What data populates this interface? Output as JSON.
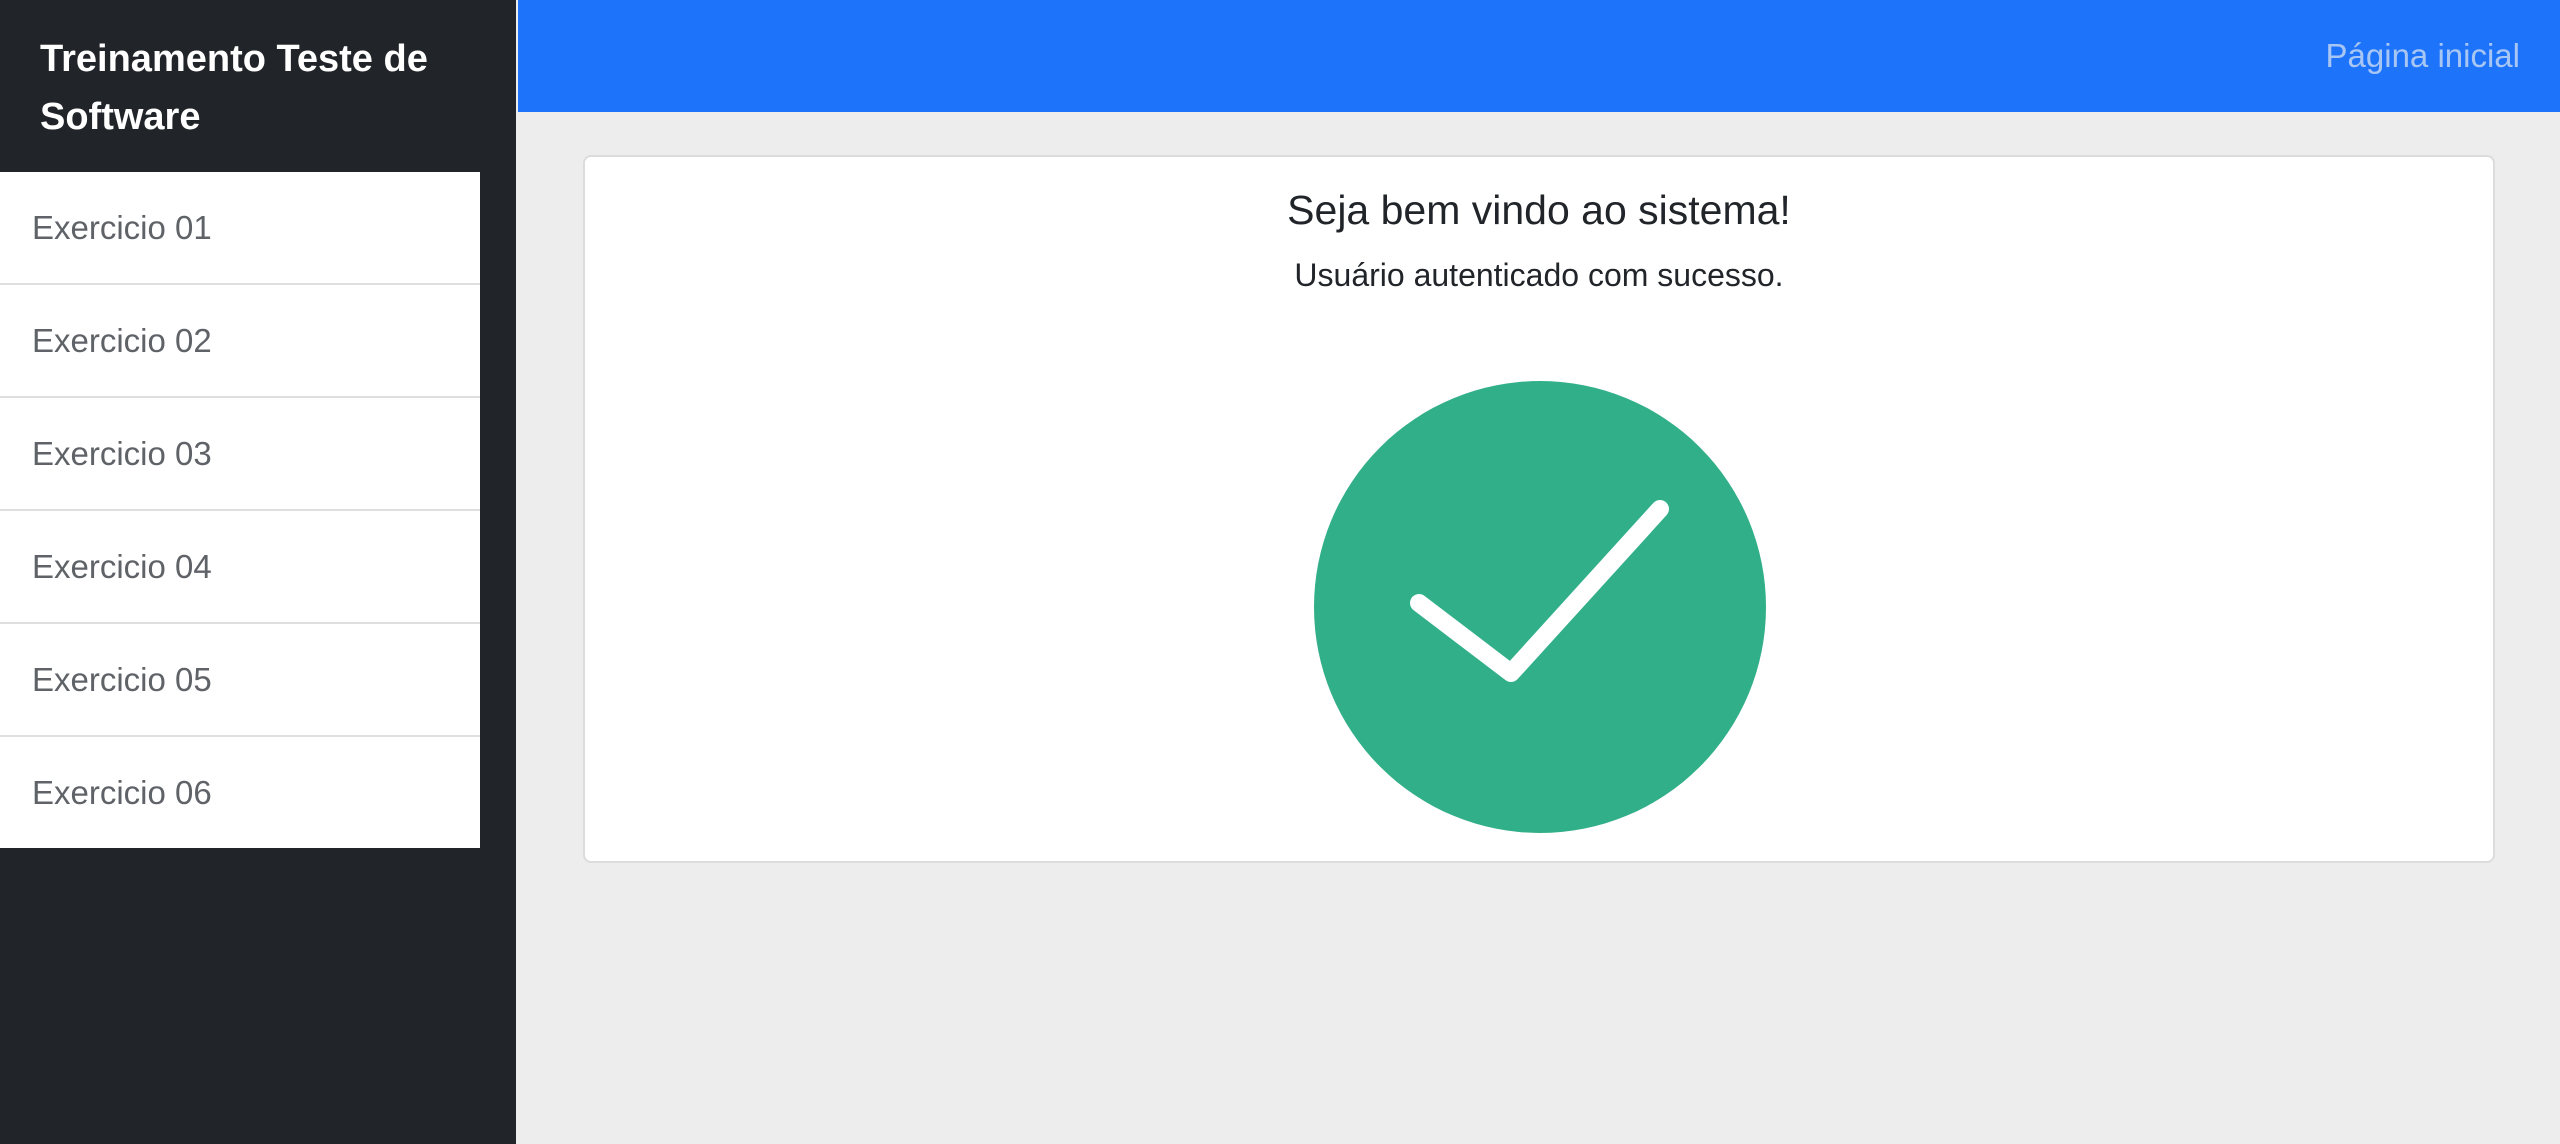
{
  "sidebar": {
    "brand": "Treinamento Teste de Software",
    "items": [
      {
        "label": "Exercicio 01"
      },
      {
        "label": "Exercicio 02"
      },
      {
        "label": "Exercicio 03"
      },
      {
        "label": "Exercicio 04"
      },
      {
        "label": "Exercicio 05"
      },
      {
        "label": "Exercicio 06"
      }
    ]
  },
  "header": {
    "home_link": "Página inicial"
  },
  "main": {
    "title": "Seja bem vindo ao sistema!",
    "subtitle": "Usuário autenticado com sucesso.",
    "status_icon": "check-circle-icon"
  },
  "colors": {
    "sidebar_bg": "#212529",
    "topbar_bg": "#1d74fb",
    "success": "#31af89",
    "page_bg": "#ededed"
  }
}
